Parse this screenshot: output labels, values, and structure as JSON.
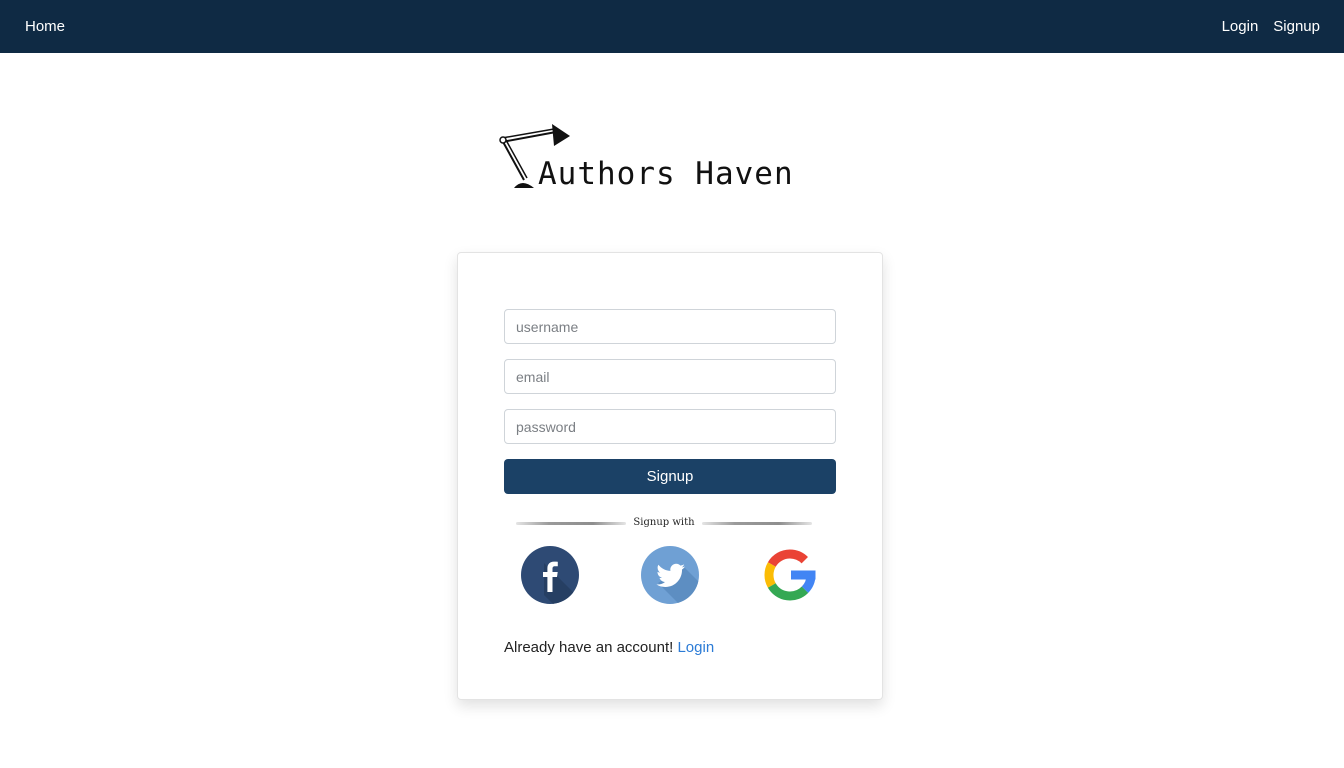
{
  "navbar": {
    "home_label": "Home",
    "login_label": "Login",
    "signup_label": "Signup",
    "background": "#0f2a44"
  },
  "logo": {
    "text": "Authors Haven",
    "icon": "desk-lamp-icon"
  },
  "form": {
    "username_placeholder": "username",
    "email_placeholder": "email",
    "password_placeholder": "password",
    "username_value": "",
    "email_value": "",
    "password_value": "",
    "submit_label": "Signup",
    "submit_color": "#1b4166"
  },
  "social": {
    "divider_text": "Signup with",
    "providers": [
      {
        "name": "facebook",
        "icon": "facebook-icon",
        "color": "#2e4a74"
      },
      {
        "name": "twitter",
        "icon": "twitter-icon",
        "color": "#6fa0d4"
      },
      {
        "name": "google",
        "icon": "google-icon",
        "color": "#4285f4"
      }
    ]
  },
  "footer": {
    "prompt_text": "Already have an account! ",
    "login_link": "Login",
    "link_color": "#2b7bd6"
  }
}
